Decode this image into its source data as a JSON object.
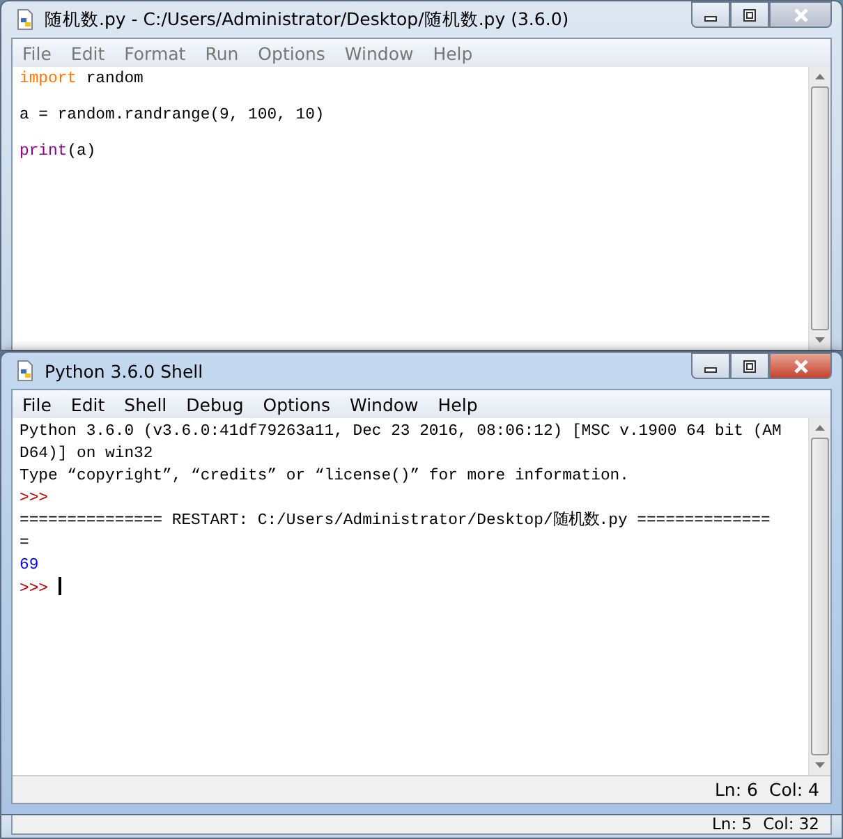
{
  "editor": {
    "title": "随机数.py - C:/Users/Administrator/Desktop/随机数.py (3.6.0)",
    "active": false,
    "menu": [
      "File",
      "Edit",
      "Format",
      "Run",
      "Options",
      "Window",
      "Help"
    ],
    "lines": [
      [
        {
          "text": "import",
          "kind": "keyword"
        },
        {
          "text": " random",
          "kind": "plain"
        }
      ],
      [
        {
          "text": "a = random.randrange(9, 100, 10)",
          "kind": "plain"
        }
      ],
      [
        {
          "text": "print",
          "kind": "builtin"
        },
        {
          "text": "(a)",
          "kind": "plain"
        }
      ]
    ],
    "status": [
      "Ln: 5",
      "Col: 32"
    ]
  },
  "shell": {
    "title": "Python 3.6.0 Shell",
    "active": true,
    "menu": [
      "File",
      "Edit",
      "Shell",
      "Debug",
      "Options",
      "Window",
      "Help"
    ],
    "lines": [
      {
        "text": "Python 3.6.0 (v3.6.0:41df79263a11, Dec 23 2016, 08:06:12) [MSC v.1900 64 bit (AM",
        "kind": "output"
      },
      {
        "text": "D64)] on win32",
        "kind": "output"
      },
      {
        "text": "Type “copyright”, “credits” or “license()” for more information.",
        "kind": "output"
      },
      {
        "text": ">>>",
        "kind": "prompt"
      },
      {
        "text": "=============== RESTART: C:/Users/Administrator/Desktop/随机数.py ==============",
        "kind": "output"
      },
      {
        "text": "=",
        "kind": "output"
      },
      {
        "text": "69",
        "kind": "result"
      },
      {
        "text": ">>>",
        "kind": "prompt",
        "cursor": true
      }
    ],
    "status": [
      "Ln: 6",
      "Col: 4"
    ]
  }
}
